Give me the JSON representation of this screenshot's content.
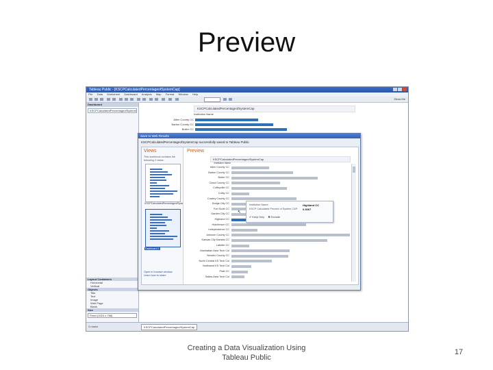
{
  "slide": {
    "title": "Preview",
    "footer": "Creating a Data Visualization Using Tableau Public",
    "page_number": "17"
  },
  "app": {
    "window_title": "Tableau Public - [KSCPCalculatedPercentageofSystemCap]",
    "menu": [
      "File",
      "Data",
      "Worksheet",
      "Dashboard",
      "Analysis",
      "Map",
      "Format",
      "Window",
      "Help"
    ],
    "show_me": "Show Me",
    "dashboard_header": "Dashboard",
    "dashboard_item": "KSCPCalculatedPercentageofSystemCap",
    "layout_header": "Layout Containers",
    "layout_items": [
      "Horizontal",
      "Vertical"
    ],
    "objects_header": "Objects",
    "objects": [
      "Title",
      "Text",
      "Image",
      "Web Page",
      "Blank"
    ],
    "size_header": "Size",
    "size_value": "Fixed (1024 x 768)",
    "status_tab": "KSCPCalculatedPercentageofSystemCap",
    "status_info": "3 marks"
  },
  "background_view": {
    "header": "KSCPCalculatedPercentageofSystemCap",
    "column_header": "Institution Name",
    "rows": [
      {
        "label": "Allen County CC",
        "value": 0.42
      },
      {
        "label": "Barton County CC",
        "value": 0.52
      },
      {
        "label": "Butler CC",
        "value": 0.61
      }
    ]
  },
  "dialog": {
    "title": "Save to Web Results",
    "url_line": "KSCPCalculatedPercentageofSystemCap successfully saved to Tableau Public",
    "views_title": "Views",
    "views_desc": "This workbook contains the following 2 views:",
    "thumb_labels": [
      "KSCPCalculatedPercentageofSystemCap",
      "Dashboard 1"
    ],
    "links": [
      "Open in browser window",
      "Learn how to share"
    ],
    "preview_title": "Preview",
    "preview_header": "KSCPCalculatedPercentageofSystemCap",
    "column_header": "Institution Name",
    "tooltip": {
      "k1": "Institution Name:",
      "v1": "Highland CC",
      "k2": "KSCP Calculated Percent of System CAP:",
      "v2": "0.3067",
      "keep": "Keep Only",
      "exclude": "Exclude"
    }
  },
  "chart_data": {
    "type": "bar",
    "orientation": "horizontal",
    "categories": [
      "Allen County CC",
      "Barton County CC",
      "Butler CC",
      "Cloud County CC",
      "Coffeyville CC",
      "Colby CC",
      "Cowley County CC",
      "Dodge City CC",
      "Fort Scott CC",
      "Garden City CC",
      "Highland CC",
      "Hutchinson CC",
      "Independence CC",
      "Johnson County CC",
      "Kansas City Kansas CC",
      "Labette CC",
      "Manhattan Area Tech Col",
      "Neosho County CC",
      "North Central KS Tech Col",
      "Northwest KS Tech Col",
      "Pratt CC",
      "Salina Area Tech Col"
    ],
    "values": [
      0.23,
      0.38,
      0.53,
      0.3,
      0.34,
      0.11,
      0.4,
      0.31,
      0.3,
      0.27,
      0.31,
      0.46,
      0.16,
      0.73,
      0.59,
      0.11,
      0.36,
      0.35,
      0.25,
      0.12,
      0.1,
      0.08
    ],
    "highlighted": "Highland CC",
    "xlim": [
      0,
      0.8
    ]
  }
}
